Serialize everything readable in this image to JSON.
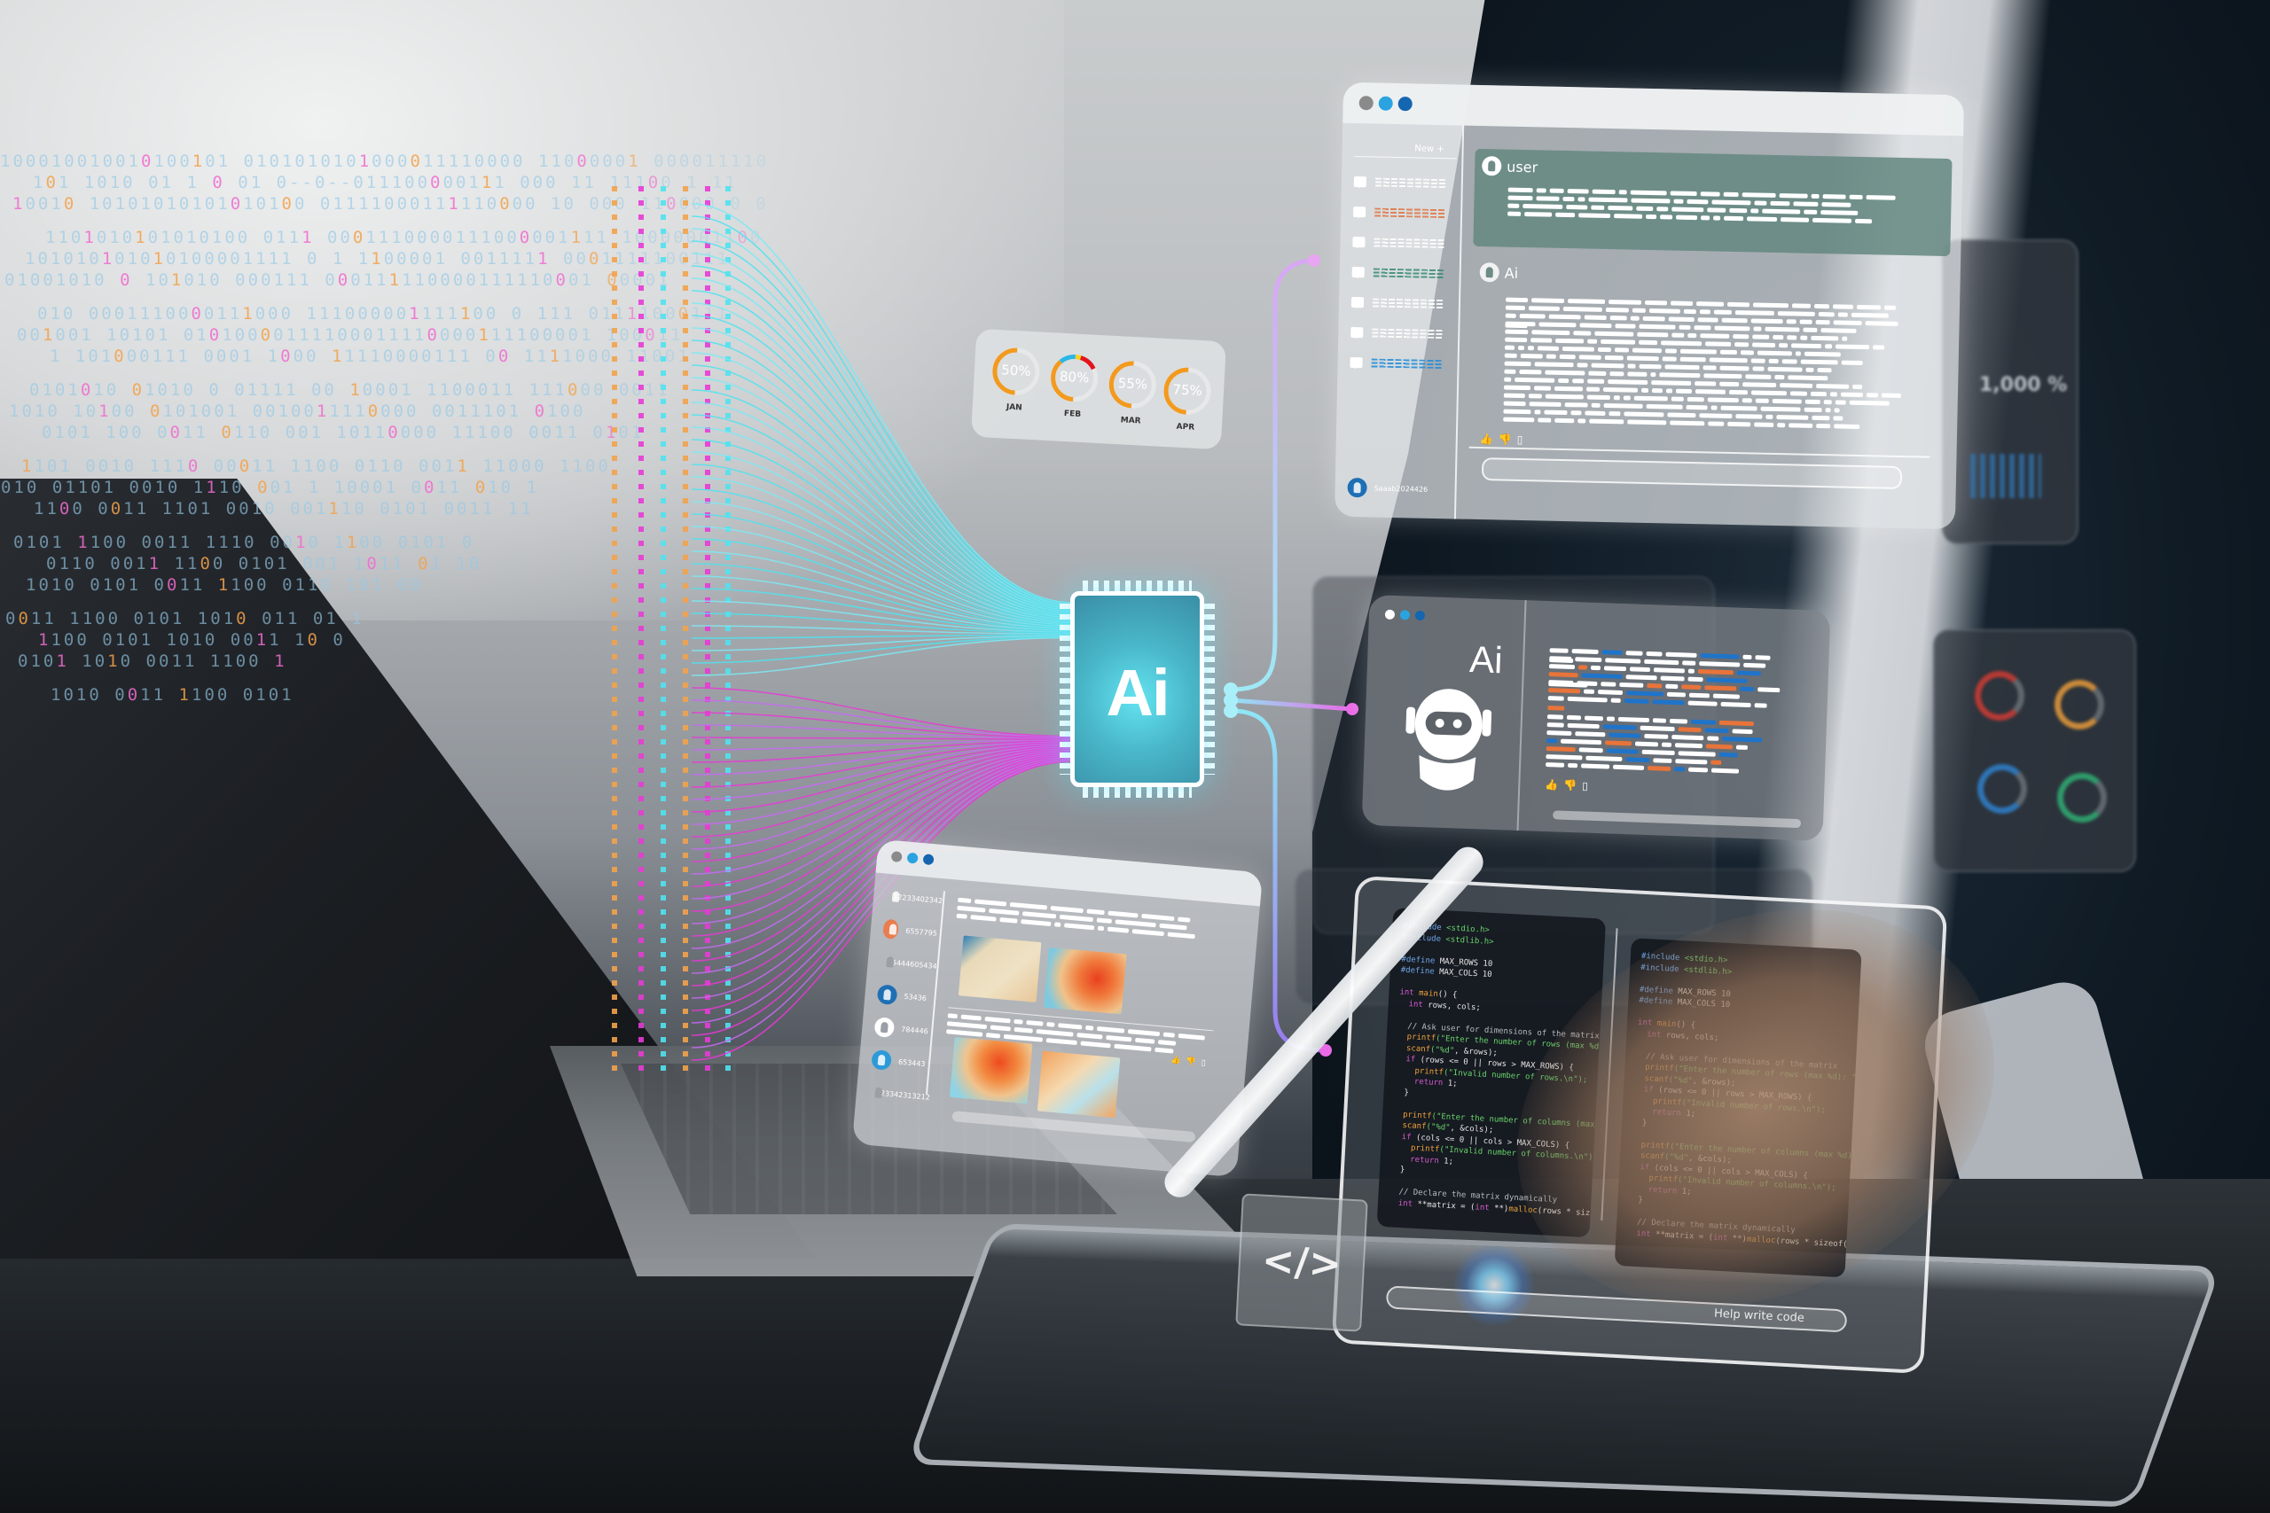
{
  "scene": {
    "description": "AI assistant holographic interface over laptop and tablet",
    "colors": {
      "accent_cyan": "#4fe3f0",
      "accent_magenta": "#e83ad6",
      "accent_purple": "#b58cf0",
      "orange": "#f39a1e",
      "blue": "#1f7ac4",
      "teal": "#6e8b86"
    }
  },
  "binary_stream": {
    "rows": [
      "100010010010100101 0101010101000011110000 11000001 000011110",
      "101 1010 01 1 0 01 0--0--011100000111 000 11 11100 1 11",
      "10010 10101010101010100 01111000111110000 10 000 110000 0 0",
      "1101010101010100 0111 0001110000111000001111 10000001100",
      "101010101010100001111 0 1 1100001 0011111 0001111100111",
      "01001010 0 101010 000111 000111110000111110001 00001",
      "010 0001110000111000 111000001111100 0 111 01111000111",
      "001001 10101 01010000111100011110000111100001 100011",
      "1 101000111 0001 1000 11110000111 00 1111000 11001",
      "0101010 01010 0 01111 00 10001 1100011 111000 0011",
      "1010 10100 0101001 0010011110000 0011101 0100",
      "0101 100 0011 0110 001 10110000 11100 0011 0101",
      "1101 0010 1110 00011 1100 0110 0011 11000 1100",
      "010 01101 0010 1110 001 1 10001 0011 010 1",
      "1100 0011 1101 0010 001110 0101 0011 11",
      "0101 1100 0011 1110 0010 1100 0101 0",
      "0110 0011 1100 0101 001 1011 01 10",
      "1010 0101 0011 1100 0110 101 00",
      "0011 1100 0101 1010 011 01 1",
      "1100 0101 1010 0011 10 0",
      "0101 1010 0011 1100 1",
      "1010 0011 1100 0101"
    ]
  },
  "ai_chip": {
    "label": "Ai"
  },
  "gauges_panel": {
    "gauges": [
      {
        "month": "JAN",
        "label": "50%",
        "value": 50,
        "segments": [
          {
            "color": "#f39a1e",
            "fraction": 0.5
          },
          {
            "color": "#29b6e8",
            "fraction": 0.17
          }
        ]
      },
      {
        "month": "FEB",
        "label": "80%",
        "value": 80,
        "segments": [
          {
            "color": "#f39a1e",
            "fraction": 0.38
          },
          {
            "color": "#29b6e8",
            "fraction": 0.17
          },
          {
            "color": "#f7d21c",
            "fraction": 0.12
          },
          {
            "color": "#e3141c",
            "fraction": 0.13
          }
        ]
      },
      {
        "month": "MAR",
        "label": "55%",
        "value": 55,
        "segments": [
          {
            "color": "#f39a1e",
            "fraction": 0.55
          }
        ]
      },
      {
        "month": "APR",
        "label": "75%",
        "value": 75,
        "segments": [
          {
            "color": "#f39a1e",
            "fraction": 0.75
          }
        ]
      }
    ]
  },
  "chat_panel": {
    "window_dots": [
      "#8a8a8a",
      "#2aa3e0",
      "#1466b0"
    ],
    "new_button_label": "New +",
    "history_items": [
      {
        "color": "#ffffff"
      },
      {
        "color": "#e07a4a"
      },
      {
        "color": "#ffffff"
      },
      {
        "color": "#3f8f76"
      },
      {
        "color": "#ffffff"
      },
      {
        "color": "#ffffff"
      },
      {
        "color": "#2a8fd8"
      }
    ],
    "account_name": "Saaab2024426",
    "user_label": "user",
    "ai_label": "Ai",
    "reactions": {
      "like": "👍",
      "dislike": "👎",
      "copy": "▯"
    }
  },
  "robot_panel": {
    "window_dots": [
      "#ffffff",
      "#2aa3e0",
      "#1466b0"
    ],
    "title": "Ai",
    "reactions": {
      "like": "👍",
      "dislike": "👎",
      "copy": "▯"
    }
  },
  "photo_panel": {
    "window_dots": [
      "#8a8a8a",
      "#2aa3e0",
      "#1466b0"
    ],
    "users": [
      {
        "id": "12233402342",
        "color": "#2c7a66"
      },
      {
        "id": "6557795",
        "color": "#e97d4f"
      },
      {
        "id": "55444605434",
        "color": "#ffffff"
      },
      {
        "id": "53436",
        "color": "#1f6fb4"
      },
      {
        "id": "784446",
        "color": "#ffffff"
      },
      {
        "id": "653443",
        "color": "#2d9ad8"
      },
      {
        "id": "123342313212",
        "color": "#ffffff"
      }
    ],
    "reactions": {
      "like": "👍",
      "dislike": "👎",
      "copy": "▯"
    }
  },
  "code_panel": {
    "code_left": [
      [
        [
          "pp",
          "#include "
        ],
        [
          "str",
          "<stdio.h>"
        ]
      ],
      [
        [
          "pp",
          "#include "
        ],
        [
          "str",
          "<stdlib.h>"
        ]
      ],
      [],
      [
        [
          "pp",
          "#define "
        ],
        [
          "num",
          "MAX_ROWS 10"
        ]
      ],
      [
        [
          "pp",
          "#define "
        ],
        [
          "num",
          "MAX_COLS 10"
        ]
      ],
      [],
      [
        [
          "kw",
          "int "
        ],
        [
          "fn",
          "main"
        ],
        [
          "num",
          "() {"
        ]
      ],
      [
        [
          "kw",
          "  int "
        ],
        [
          "num",
          "rows, cols;"
        ]
      ],
      [],
      [
        [
          "cm",
          "  // Ask user for dimensions of the matrix"
        ]
      ],
      [
        [
          "fn",
          "  printf"
        ],
        [
          "str",
          "(\"Enter the number of rows (max %d): \""
        ],
        [
          "num",
          ", MAX_ROWS);"
        ]
      ],
      [
        [
          "fn",
          "  scanf"
        ],
        [
          "str",
          "(\"%d\""
        ],
        [
          "num",
          ", &rows);"
        ]
      ],
      [
        [
          "kw",
          "  if "
        ],
        [
          "num",
          "(rows <= 0 || rows > MAX_ROWS) {"
        ]
      ],
      [
        [
          "fn",
          "    printf"
        ],
        [
          "str",
          "(\"Invalid number of rows.\\n\");"
        ]
      ],
      [
        [
          "kw",
          "    return "
        ],
        [
          "num",
          "1;"
        ]
      ],
      [
        [
          "num",
          "  }"
        ]
      ],
      [],
      [
        [
          "fn",
          "  printf"
        ],
        [
          "str",
          "(\"Enter the number of columns (max %d): \""
        ],
        [
          "num",
          ", MAX_COLS);"
        ]
      ],
      [
        [
          "fn",
          "  scanf"
        ],
        [
          "str",
          "(\"%d\""
        ],
        [
          "num",
          ", &cols);"
        ]
      ],
      [
        [
          "kw",
          "  if "
        ],
        [
          "num",
          "(cols <= 0 || cols > MAX_COLS) {"
        ]
      ],
      [
        [
          "fn",
          "    printf"
        ],
        [
          "str",
          "(\"Invalid number of columns.\\n\");"
        ]
      ],
      [
        [
          "kw",
          "    return "
        ],
        [
          "num",
          "1;"
        ]
      ],
      [
        [
          "num",
          "  }"
        ]
      ],
      [],
      [
        [
          "cm",
          "  // Declare the matrix dynamically"
        ]
      ],
      [
        [
          "kw",
          "  int "
        ],
        [
          "num",
          "**matrix = ("
        ],
        [
          "kw",
          "int "
        ],
        [
          "num",
          "**)"
        ],
        [
          "fn",
          "malloc"
        ],
        [
          "num",
          "(rows * sizeof(int*));"
        ]
      ]
    ],
    "help_input_placeholder": "Help write code"
  },
  "code_icon": {
    "glyph": "</>"
  },
  "background_panels": {
    "percent_readout": "1,000 %",
    "gauge_colors": [
      "#b53a35",
      "#c98a3a",
      "#2f74b5",
      "#2f9a6a"
    ]
  }
}
